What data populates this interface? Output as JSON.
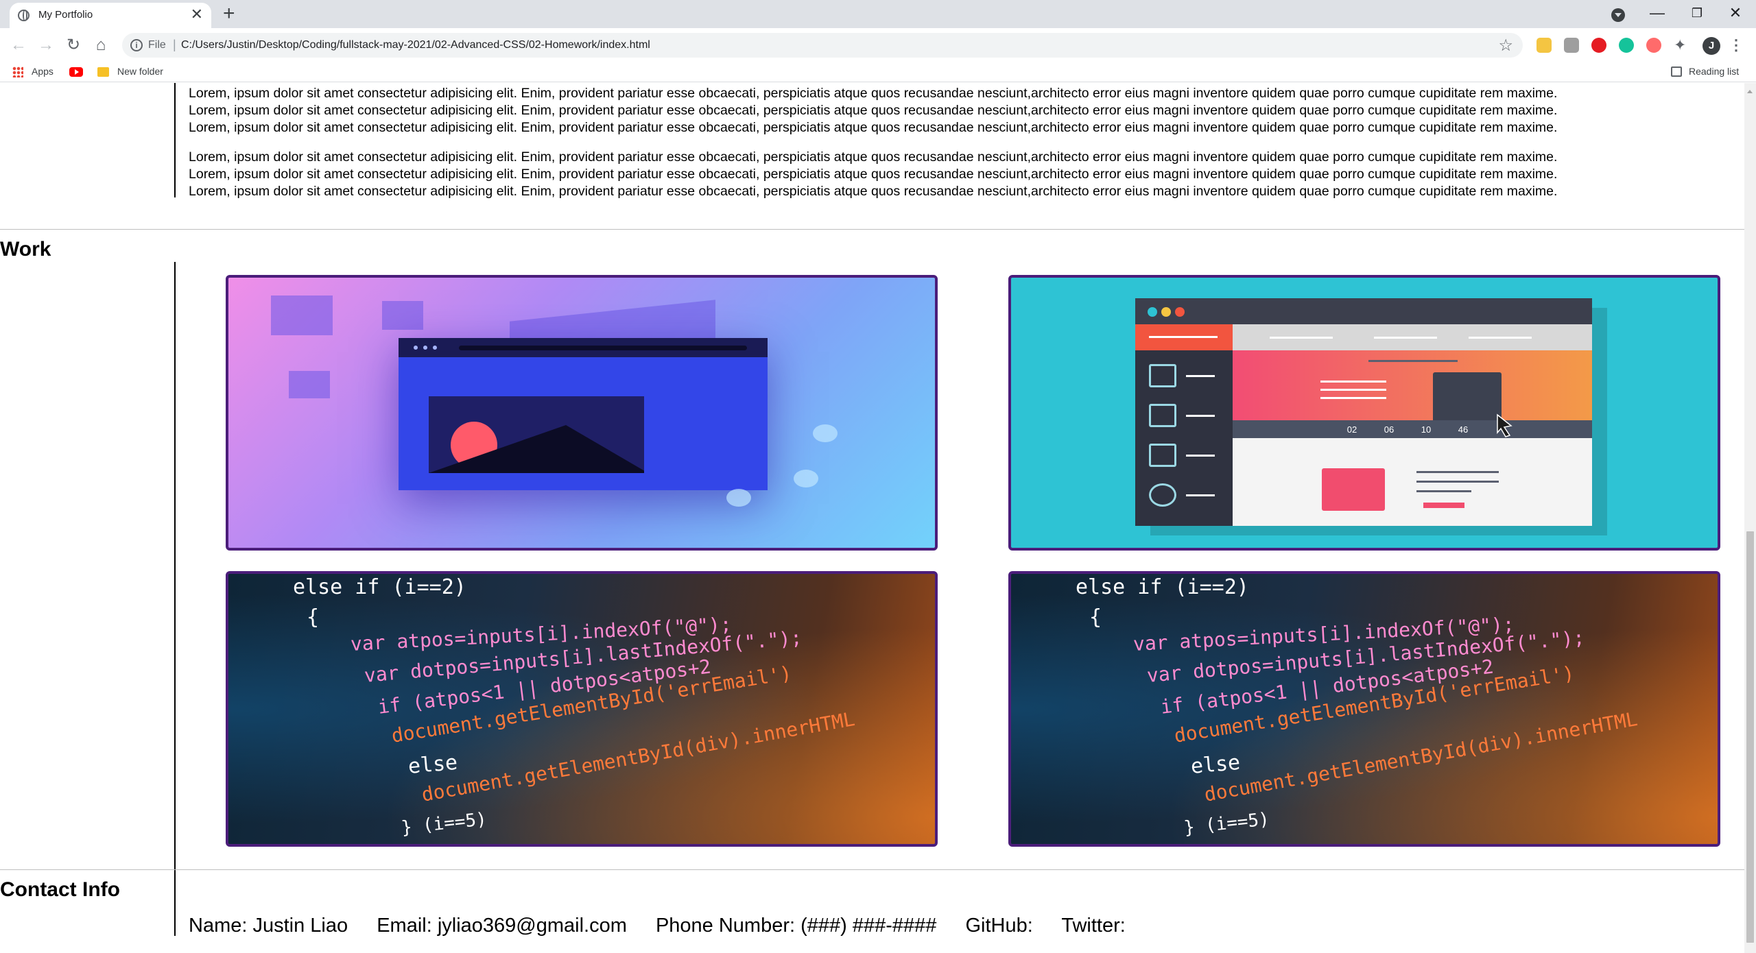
{
  "browser": {
    "tab_title": "My Portfolio",
    "tab_close": "✕",
    "new_tab": "+",
    "url_scheme": "File",
    "url_sep": "|",
    "url": "C:/Users/Justin/Desktop/Coding/fullstack-may-2021/02-Advanced-CSS/02-Homework/index.html",
    "avatar_initial": "J",
    "bookmarks": {
      "apps": "Apps",
      "folder": "New folder",
      "reading_list": "Reading list"
    },
    "window_controls": {
      "minimize": "—",
      "restore": "❐",
      "close": "✕"
    },
    "nav": {
      "back": "←",
      "forward": "→",
      "reload": "↻",
      "home": "⌂"
    },
    "star": "☆",
    "menu": "⋮"
  },
  "about": {
    "paragraphs": [
      [
        "Lorem, ipsum dolor sit amet consectetur adipisicing elit. Enim, provident pariatur esse obcaecati, perspiciatis atque quos recusandae nesciunt,architecto error eius magni inventore quidem quae porro cumque cupiditate rem maxime.",
        "Lorem, ipsum dolor sit amet consectetur adipisicing elit. Enim, provident pariatur esse obcaecati, perspiciatis atque quos recusandae nesciunt,architecto error eius magni inventore quidem quae porro cumque cupiditate rem maxime.",
        "Lorem, ipsum dolor sit amet consectetur adipisicing elit. Enim, provident pariatur esse obcaecati, perspiciatis atque quos recusandae nesciunt,architecto error eius magni inventore quidem quae porro cumque cupiditate rem maxime."
      ],
      [
        "Lorem, ipsum dolor sit amet consectetur adipisicing elit. Enim, provident pariatur esse obcaecati, perspiciatis atque quos recusandae nesciunt,architecto error eius magni inventore quidem quae porro cumque cupiditate rem maxime.",
        "Lorem, ipsum dolor sit amet consectetur adipisicing elit. Enim, provident pariatur esse obcaecati, perspiciatis atque quos recusandae nesciunt,architecto error eius magni inventore quidem quae porro cumque cupiditate rem maxime.",
        "Lorem, ipsum dolor sit amet consectetur adipisicing elit. Enim, provident pariatur esse obcaecati, perspiciatis atque quos recusandae nesciunt,architecto error eius magni inventore quidem quae porro cumque cupiditate rem maxime."
      ]
    ]
  },
  "work": {
    "title": "Work",
    "code_lines": [
      "else if (i==2)",
      "{",
      "var atpos=inputs[i].indexOf(\"@\");",
      "var dotpos=inputs[i].lastIndexOf(\".\");",
      "if (atpos<1 || dotpos<atpos+2",
      "document.getElementById('errEmail')",
      "else",
      "document.getElementById(div).innerHTML",
      "} (i==5)"
    ],
    "panel_numbers": [
      "02",
      "06",
      "10",
      "46"
    ]
  },
  "contact": {
    "title": "Contact Info",
    "name": "Name: Justin Liao",
    "email": "Email: jyliao369@gmail.com",
    "phone": "Phone Number: (###) ###-####",
    "github": "GitHub:",
    "twitter": "Twitter:"
  },
  "colors": {
    "card_border": "#4b1d7a",
    "tab_bg": "#dee1e6",
    "card2_bg": "#2ec3d4"
  }
}
